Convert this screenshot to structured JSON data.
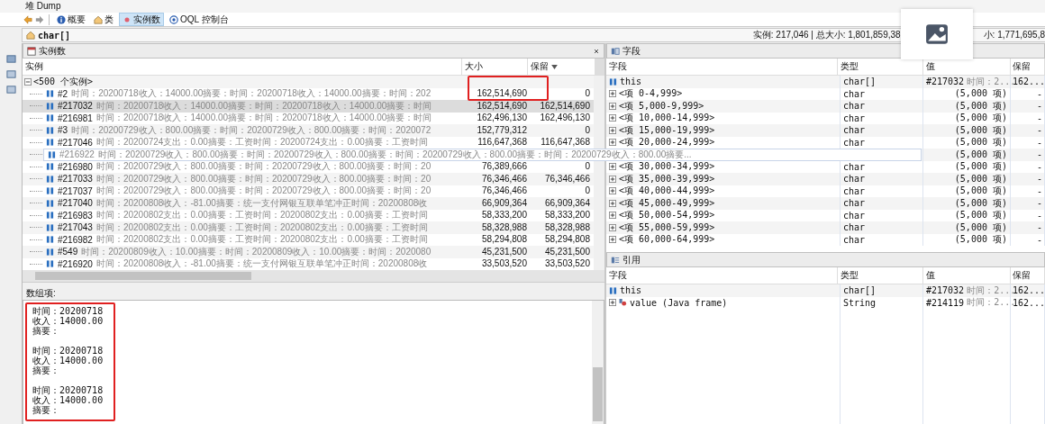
{
  "window": {
    "title": "堆 Dump"
  },
  "toolbar": [
    {
      "label": "概要",
      "selected": false
    },
    {
      "label": "类",
      "selected": false
    },
    {
      "label": "实例数",
      "selected": true
    },
    {
      "label": "OQL 控制台",
      "selected": false
    }
  ],
  "class_bar": {
    "name": "char[]",
    "status": "实例: 217,046 | 总大小: 1,801,859,38",
    "status_tail": "小: 1,771,695,8"
  },
  "instances": {
    "title": "实例数",
    "columns": [
      {
        "label": "实例",
        "sorted": false
      },
      {
        "label": "大小",
        "sorted": false
      },
      {
        "label": "保留",
        "sorted": true
      }
    ],
    "group": {
      "label": "<500 个实例>",
      "expanded": true
    },
    "rows": [
      {
        "id": "#2",
        "preview": "时间：20200718收入：14000.00摘要：时间：20200718收入：14000.00摘要：时间：202",
        "size": "162,514,690",
        "retained": "0",
        "selected": false,
        "highlight": true
      },
      {
        "id": "#217032",
        "preview": "时间：20200718收入：14000.00摘要：时间：20200718收入：14000.00摘要：时间",
        "size": "162,514,690",
        "retained": "162,514,690",
        "selected": true
      },
      {
        "id": "#216981",
        "preview": "时间：20200718收入：14000.00摘要：时间：20200718收入：14000.00摘要：时间",
        "size": "162,496,130",
        "retained": "162,496,130",
        "selected": false
      },
      {
        "id": "#3",
        "preview": "时间：20200729收入：800.00摘要：时间：20200729收入：800.00摘要：时间：2020072",
        "size": "152,779,312",
        "retained": "0",
        "selected": false
      },
      {
        "id": "#217046",
        "preview": "时间：20200724支出：0.00摘要：工资时间：20200724支出：0.00摘要：工资时间",
        "size": "116,647,368",
        "retained": "116,647,368",
        "selected": false
      },
      {
        "id": "#216922",
        "tooltip": "时间：20200729收入：800.00摘要：时间：20200729收入：800.00摘要：时间：20200729收入：800.00摘要：时间：20200729收入：800.00摘要...",
        "selected": false
      },
      {
        "id": "#216980",
        "preview": "时间：20200729收入：800.00摘要：时间：20200729收入：800.00摘要：时间：20",
        "size": "76,389,666",
        "retained": "0",
        "selected": false
      },
      {
        "id": "#217033",
        "preview": "时间：20200729收入：800.00摘要：时间：20200729收入：800.00摘要：时间：20",
        "size": "76,346,466",
        "retained": "76,346,466",
        "selected": false
      },
      {
        "id": "#217037",
        "preview": "时间：20200729收入：800.00摘要：时间：20200729收入：800.00摘要：时间：20",
        "size": "76,346,466",
        "retained": "0",
        "selected": false
      },
      {
        "id": "#217040",
        "preview": "时间：20200808收入：-81.00摘要：统一支付网银互联单笔冲正时间：20200808收",
        "size": "66,909,364",
        "retained": "66,909,364",
        "selected": false
      },
      {
        "id": "#216983",
        "preview": "时间：20200802支出：0.00摘要：工资时间：20200802支出：0.00摘要：工资时间",
        "size": "58,333,200",
        "retained": "58,333,200",
        "selected": false
      },
      {
        "id": "#217043",
        "preview": "时间：20200802支出：0.00摘要：工资时间：20200802支出：0.00摘要：工资时间",
        "size": "58,328,988",
        "retained": "58,328,988",
        "selected": false
      },
      {
        "id": "#216982",
        "preview": "时间：20200802支出：0.00摘要：工资时间：20200802支出：0.00摘要：工资时间",
        "size": "58,294,808",
        "retained": "58,294,808",
        "selected": false
      },
      {
        "id": "#549",
        "preview": "时间：20200809收入：10.00摘要：时间：20200809收入：10.00摘要：时间：2020080",
        "size": "45,231,500",
        "retained": "45,231,500",
        "selected": false
      },
      {
        "id": "#216920",
        "preview": "时间：20200808收入：-81.00摘要：统一支付网银互联单笔冲正时间：20200808收",
        "size": "33,503,520",
        "retained": "33,503,520",
        "selected": false
      }
    ]
  },
  "array_items": {
    "label": "数组项:",
    "highlight": true,
    "groups": [
      [
        "时间：20200718",
        "收入：14000.00",
        "摘要："
      ],
      [
        "时间：20200718",
        "收入：14000.00",
        "摘要："
      ],
      [
        "时间：20200718",
        "收入：14000.00",
        "摘要："
      ]
    ]
  },
  "fields": {
    "title": "字段",
    "columns": [
      "字段",
      "类型",
      "值",
      "保留"
    ],
    "rows": [
      {
        "kind": "self",
        "field": "this",
        "type": "char[]",
        "value": "#217032",
        "value_preview": "时间：2...",
        "retained": "162..."
      },
      {
        "kind": "range",
        "field": "<项 0-4,999>",
        "type": "char",
        "value": "(5,000 项)",
        "retained": "-"
      },
      {
        "kind": "range",
        "field": "<项 5,000-9,999>",
        "type": "char",
        "value": "(5,000 项)",
        "retained": "-"
      },
      {
        "kind": "range",
        "field": "<项 10,000-14,999>",
        "type": "char",
        "value": "(5,000 项)",
        "retained": "-"
      },
      {
        "kind": "range",
        "field": "<项 15,000-19,999>",
        "type": "char",
        "value": "(5,000 项)",
        "retained": "-"
      },
      {
        "kind": "range",
        "field": "<项 20,000-24,999>",
        "type": "char",
        "value": "(5,000 项)",
        "retained": "-"
      },
      {
        "kind": "range",
        "value": "(5,000 项)",
        "retained": "-"
      },
      {
        "kind": "range",
        "field": "<项 30,000-34,999>",
        "type": "char",
        "value": "(5,000 项)",
        "retained": "-"
      },
      {
        "kind": "range",
        "field": "<项 35,000-39,999>",
        "type": "char",
        "value": "(5,000 项)",
        "retained": "-"
      },
      {
        "kind": "range",
        "field": "<项 40,000-44,999>",
        "type": "char",
        "value": "(5,000 项)",
        "retained": "-"
      },
      {
        "kind": "range",
        "field": "<项 45,000-49,999>",
        "type": "char",
        "value": "(5,000 项)",
        "retained": "-"
      },
      {
        "kind": "range",
        "field": "<项 50,000-54,999>",
        "type": "char",
        "value": "(5,000 项)",
        "retained": "-"
      },
      {
        "kind": "range",
        "field": "<项 55,000-59,999>",
        "type": "char",
        "value": "(5,000 项)",
        "retained": "-"
      },
      {
        "kind": "range",
        "field": "<项 60,000-64,999>",
        "type": "char",
        "value": "(5,000 项)",
        "retained": "-"
      }
    ]
  },
  "references": {
    "title": "引用",
    "columns": [
      "字段",
      "类型",
      "值",
      "保留"
    ],
    "rows": [
      {
        "kind": "self",
        "field": "this",
        "type": "char[]",
        "value": "#217032",
        "value_preview": "时间：2...",
        "retained": "162..."
      },
      {
        "kind": "frame",
        "field": "value (Java frame)",
        "type": "String",
        "value": "#214119",
        "value_preview": "时间：2...",
        "retained": "162..."
      }
    ]
  }
}
